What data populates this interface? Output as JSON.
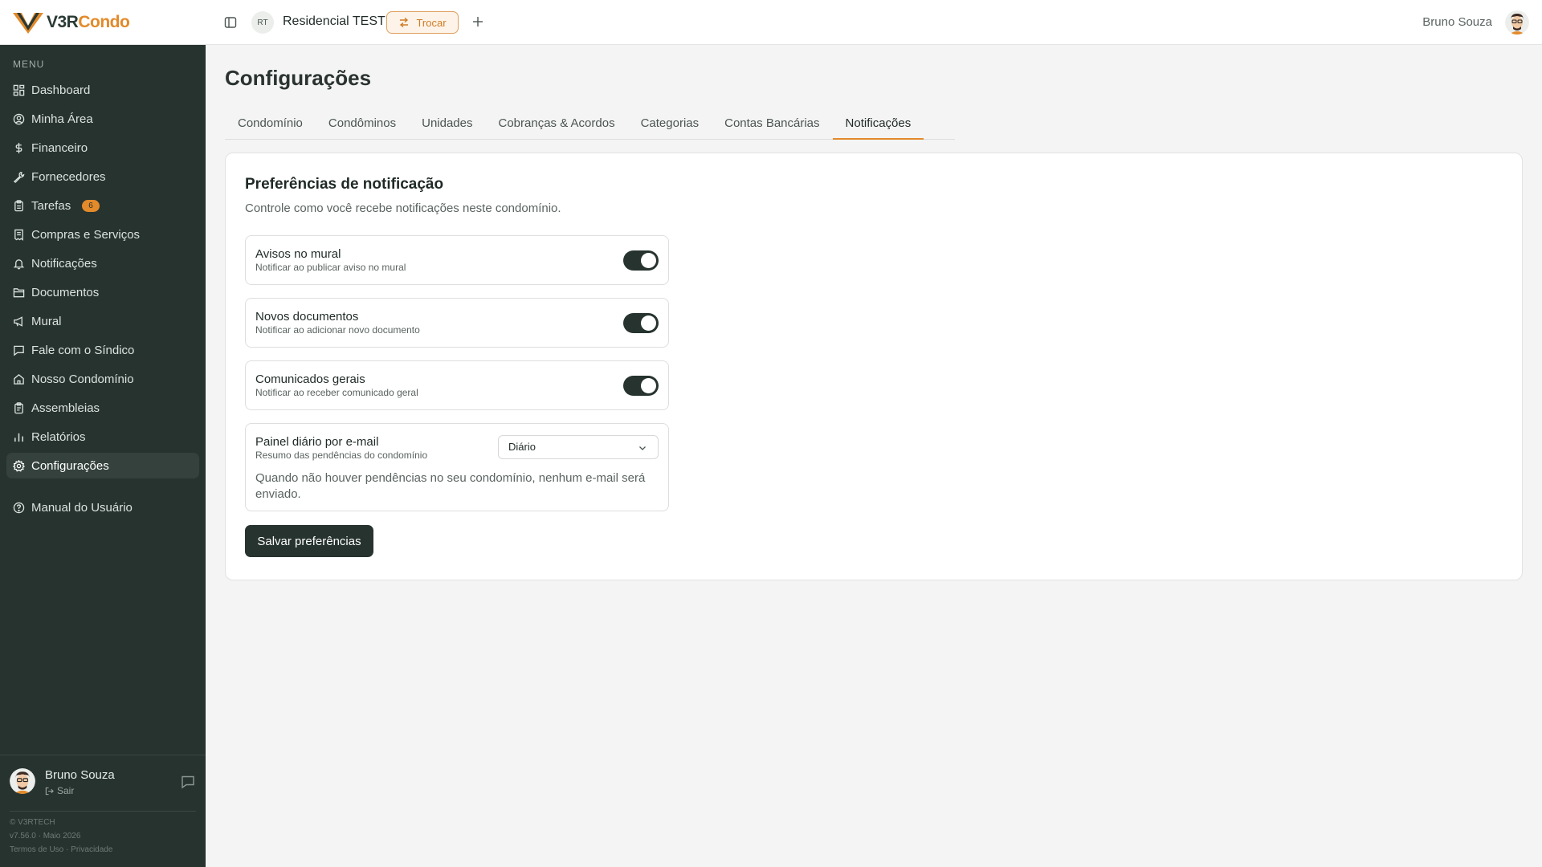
{
  "app": {
    "logo_v3r": "V3R",
    "logo_condo": "Condo",
    "condo_initials": "RT",
    "condo_name": "Residencial TESTE",
    "switch_label": "Trocar",
    "user_name": "Bruno Souza",
    "colors": {
      "accent": "#e38a2a",
      "sidebar": "#27332f",
      "toggle_on": "#26332f"
    }
  },
  "sidebar": {
    "menu_title": "MENU",
    "items": [
      {
        "label": "Dashboard",
        "icon": "dashboard-icon"
      },
      {
        "label": "Minha Área",
        "icon": "user-circle-icon"
      },
      {
        "label": "Financeiro",
        "icon": "dollar-icon"
      },
      {
        "label": "Fornecedores",
        "icon": "wrench-icon"
      },
      {
        "label": "Tarefas",
        "icon": "clipboard-icon",
        "badge": "6"
      },
      {
        "label": "Compras e Serviços",
        "icon": "receipt-icon"
      },
      {
        "label": "Notificações",
        "icon": "bell-icon"
      },
      {
        "label": "Documentos",
        "icon": "folder-icon"
      },
      {
        "label": "Mural",
        "icon": "megaphone-icon"
      },
      {
        "label": "Fale com o Síndico",
        "icon": "chat-icon"
      },
      {
        "label": "Nosso Condomínio",
        "icon": "home-icon"
      },
      {
        "label": "Assembleias",
        "icon": "clipboard-list-icon"
      },
      {
        "label": "Relatórios",
        "icon": "bar-chart-icon"
      },
      {
        "label": "Configurações",
        "icon": "gear-icon",
        "active": true
      }
    ],
    "manual": "Manual do Usuário",
    "user_name": "Bruno Souza",
    "logout": "Sair",
    "footer_copyright": "© V3RTECH",
    "footer_version": "v7.56.0 · Maio 2026",
    "footer_terms": "Termos de Uso",
    "footer_sep": "·",
    "footer_privacy": "Privacidade"
  },
  "main": {
    "title": "Configurações",
    "tabs": [
      {
        "label": "Condomínio"
      },
      {
        "label": "Condôminos"
      },
      {
        "label": "Unidades"
      },
      {
        "label": "Cobranças & Acordos"
      },
      {
        "label": "Categorias"
      },
      {
        "label": "Contas Bancárias"
      },
      {
        "label": "Notificações",
        "active": true
      }
    ],
    "card": {
      "title": "Preferências de notificação",
      "subtitle": "Controle como você recebe notificações neste condomínio.",
      "prefs": [
        {
          "title": "Avisos no mural",
          "desc": "Notificar ao publicar aviso no mural",
          "enabled": true
        },
        {
          "title": "Novos documentos",
          "desc": "Notificar ao adicionar novo documento",
          "enabled": true
        },
        {
          "title": "Comunicados gerais",
          "desc": "Notificar ao receber comunicado geral",
          "enabled": true
        }
      ],
      "digest": {
        "title": "Painel diário por e-mail",
        "desc": "Resumo das pendências do condomínio",
        "selected": "Diário",
        "note": "Quando não houver pendências no seu condomínio, nenhum e-mail será enviado."
      },
      "save_label": "Salvar preferências"
    }
  }
}
